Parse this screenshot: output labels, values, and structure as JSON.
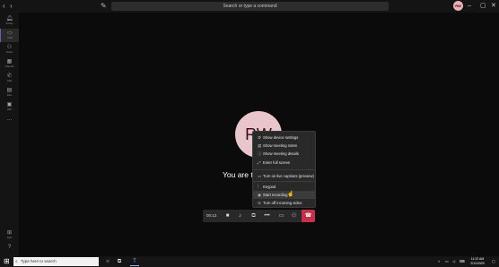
{
  "titlebar": {
    "back_icon": "chevron-left-icon",
    "forward_icon": "chevron-right-icon",
    "compose_icon": "compose-icon",
    "search_placeholder": "Search or type a command",
    "profile_initials": "RW",
    "minimize_icon": "minimize-icon",
    "maximize_icon": "maximize-icon",
    "close_icon": "close-icon"
  },
  "rail": {
    "items": [
      {
        "label": "Activity",
        "icon": "bell-icon"
      },
      {
        "label": "Chat",
        "icon": "chat-icon"
      },
      {
        "label": "Teams",
        "icon": "teams-icon"
      },
      {
        "label": "Calendar",
        "icon": "calendar-icon"
      },
      {
        "label": "Calls",
        "icon": "phone-icon"
      },
      {
        "label": "Files",
        "icon": "file-icon"
      },
      {
        "label": "Wiki",
        "icon": "wiki-icon"
      },
      {
        "label": "...",
        "icon": "more-icon"
      },
      {
        "label": "Apps",
        "icon": "apps-icon"
      },
      {
        "label": "Help",
        "icon": "help-icon"
      }
    ],
    "active_index": 1
  },
  "meeting": {
    "avatar_initials": "RW",
    "only_message": "You are the"
  },
  "more_menu": {
    "items": [
      {
        "label": "Show device settings",
        "icon": "gear-icon"
      },
      {
        "label": "Show meeting notes",
        "icon": "notes-icon"
      },
      {
        "label": "Show meeting details",
        "icon": "info-icon"
      },
      {
        "label": "Enter full screen",
        "icon": "fullscreen-icon"
      },
      {
        "label": "Turn on live captions (preview)",
        "icon": "captions-icon"
      },
      {
        "label": "Keypad",
        "icon": "keypad-icon"
      },
      {
        "label": "Start recording",
        "icon": "record-icon"
      },
      {
        "label": "Turn off incoming video",
        "icon": "video-off-icon"
      }
    ],
    "hovered": "Start recording"
  },
  "controls": {
    "timer": "00:13",
    "camera_icon": "video-camera-icon",
    "mic_icon": "mic-off-icon",
    "share_icon": "share-screen-icon",
    "more_icon": "more-actions-icon",
    "chat_icon": "conversation-icon",
    "participants_icon": "participants-icon",
    "hangup_icon": "phone-hangup-icon",
    "hangup_color": "#c4314b"
  },
  "taskbar": {
    "search_placeholder": "Type here to search",
    "time": "11:22 AM",
    "date": "2/11/2020"
  }
}
